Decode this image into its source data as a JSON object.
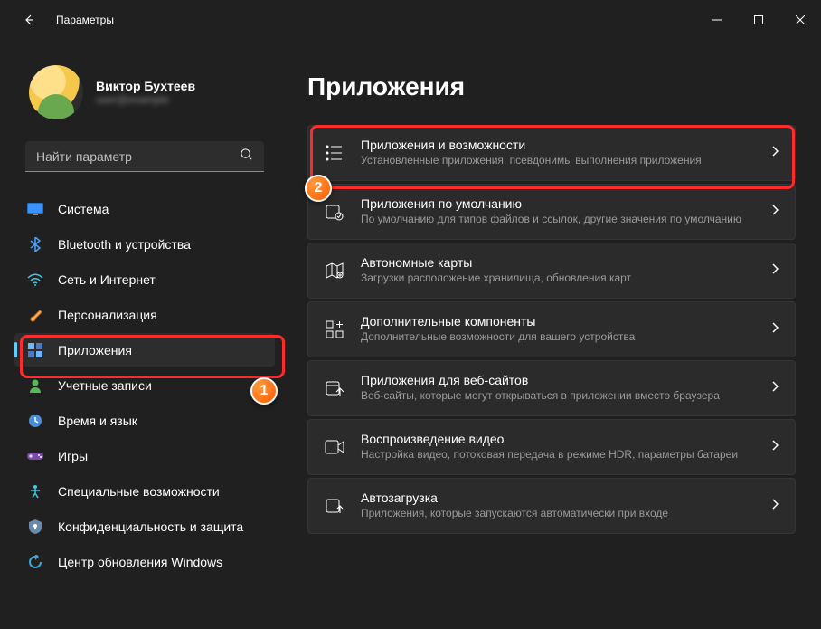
{
  "window": {
    "title": "Параметры"
  },
  "user": {
    "name": "Виктор Бухтеев",
    "sub": "user@example"
  },
  "search": {
    "placeholder": "Найти параметр"
  },
  "sidebar": {
    "items": [
      {
        "label": "Система",
        "icon": "system"
      },
      {
        "label": "Bluetooth и устройства",
        "icon": "bluetooth"
      },
      {
        "label": "Сеть и Интернет",
        "icon": "wifi"
      },
      {
        "label": "Персонализация",
        "icon": "brush"
      },
      {
        "label": "Приложения",
        "icon": "apps",
        "active": true
      },
      {
        "label": "Учетные записи",
        "icon": "account"
      },
      {
        "label": "Время и язык",
        "icon": "time"
      },
      {
        "label": "Игры",
        "icon": "games"
      },
      {
        "label": "Специальные возможности",
        "icon": "a11y"
      },
      {
        "label": "Конфиденциальность и защита",
        "icon": "privacy"
      },
      {
        "label": "Центр обновления Windows",
        "icon": "update"
      }
    ]
  },
  "page": {
    "title": "Приложения",
    "cards": [
      {
        "title": "Приложения и возможности",
        "sub": "Установленные приложения, псевдонимы выполнения приложения",
        "icon": "list"
      },
      {
        "title": "Приложения по умолчанию",
        "sub": "По умолчанию для типов файлов и ссылок, другие значения по умолчанию",
        "icon": "default"
      },
      {
        "title": "Автономные карты",
        "sub": "Загрузки расположение хранилища, обновления карт",
        "icon": "map"
      },
      {
        "title": "Дополнительные компоненты",
        "sub": "Дополнительные возможности для вашего устройства",
        "icon": "feature"
      },
      {
        "title": "Приложения для веб-сайтов",
        "sub": "Веб-сайты, которые могут открываться в приложении вместо браузера",
        "icon": "web"
      },
      {
        "title": "Воспроизведение видео",
        "sub": "Настройка видео, потоковая передача в режиме HDR, параметры батареи",
        "icon": "video"
      },
      {
        "title": "Автозагрузка",
        "sub": "Приложения, которые запускаются автоматически при входе",
        "icon": "startup"
      }
    ]
  },
  "callouts": {
    "one": "1",
    "two": "2"
  }
}
